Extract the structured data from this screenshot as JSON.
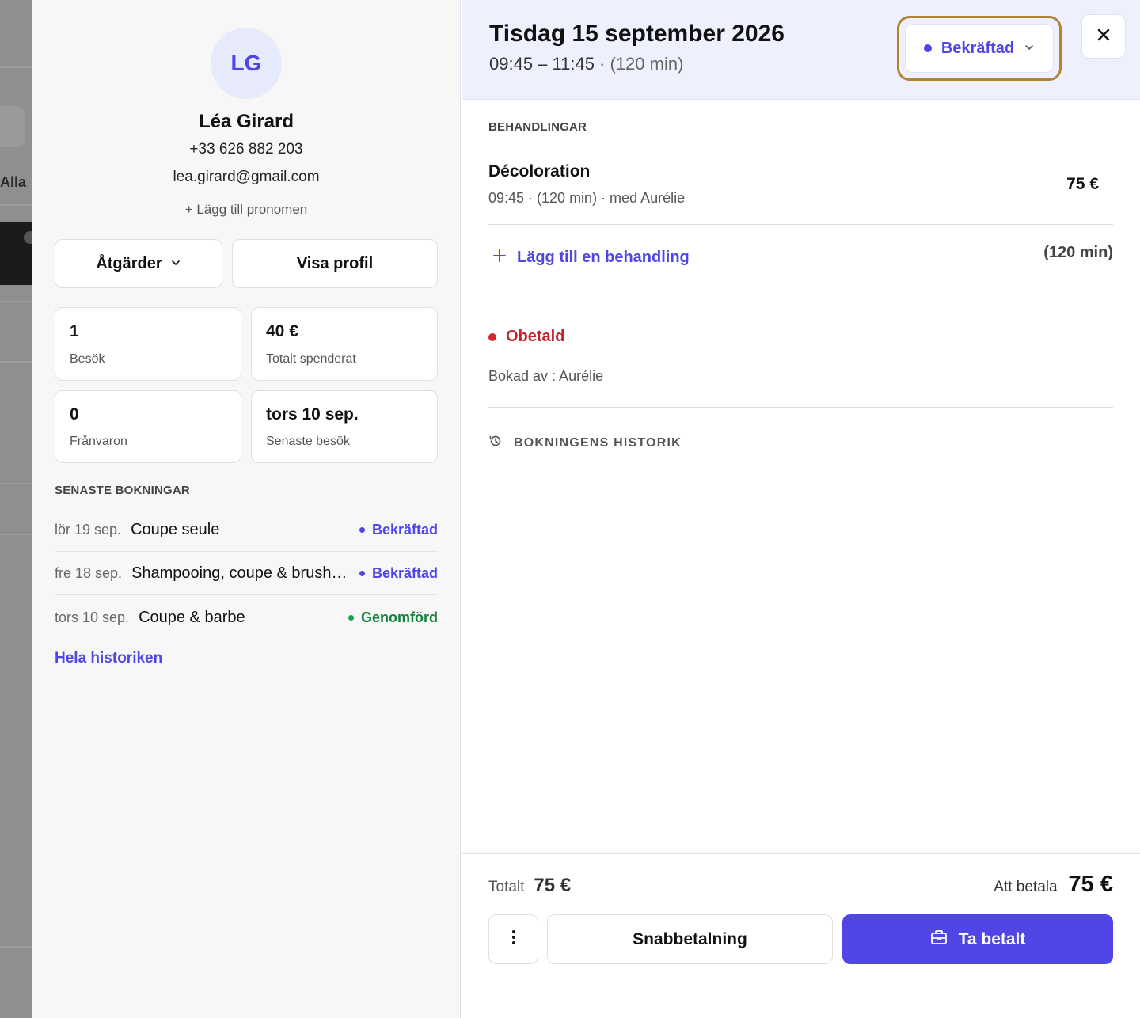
{
  "background": {
    "visible_text": "Alla"
  },
  "client": {
    "initials": "LG",
    "name": "Léa Girard",
    "phone": "+33 626 882 203",
    "email": "lea.girard@gmail.com",
    "add_pronoun": "+ Lägg till pronomen",
    "actions_label": "Åtgärder",
    "view_profile_label": "Visa profil",
    "stats": [
      {
        "value": "1",
        "label": "Besök"
      },
      {
        "value": "40 €",
        "label": "Totalt spenderat"
      },
      {
        "value": "0",
        "label": "Frånvaron"
      },
      {
        "value": "tors 10 sep.",
        "label": "Senaste besök"
      }
    ],
    "recent_title": "SENASTE BOKNINGAR",
    "recent_bookings": [
      {
        "date": "lör 19 sep.",
        "service": "Coupe seule",
        "status": "Bekräftad"
      },
      {
        "date": "fre 18 sep.",
        "service": "Shampooing, coupe & brushing",
        "status": "Bekräftad"
      },
      {
        "date": "tors 10 sep.",
        "service": "Coupe & barbe",
        "status": "Genomförd"
      }
    ],
    "history_link": "Hela historiken"
  },
  "appointment": {
    "date": "Tisdag 15 september 2026",
    "time_range": "09:45 – 11:45",
    "duration": " · (120 min)",
    "status": "Bekräftad",
    "treatments_title": "BEHANDLINGAR",
    "treatment": {
      "name": "Décoloration",
      "meta": "09:45 · (120 min) · med Aurélie",
      "price": "75 €"
    },
    "add_treatment": "Lägg till en behandling",
    "total_duration": "(120 min)",
    "payment_status": "Obetald",
    "booked_by": "Bokad av : Aurélie",
    "history_title": "BOKNINGENS HISTORIK"
  },
  "footer": {
    "total_label": "Totalt",
    "total_value": "75 €",
    "to_pay_label": "Att betala",
    "to_pay_value": "75 €",
    "quick_pay_label": "Snabbetalning",
    "pay_label": "Ta betalt"
  },
  "colors": {
    "accent": "#4f46e5",
    "header_bg": "#eef0fd",
    "unpaid": "#d7262e",
    "completed": "#15803d",
    "highlight_border": "#b08435"
  }
}
